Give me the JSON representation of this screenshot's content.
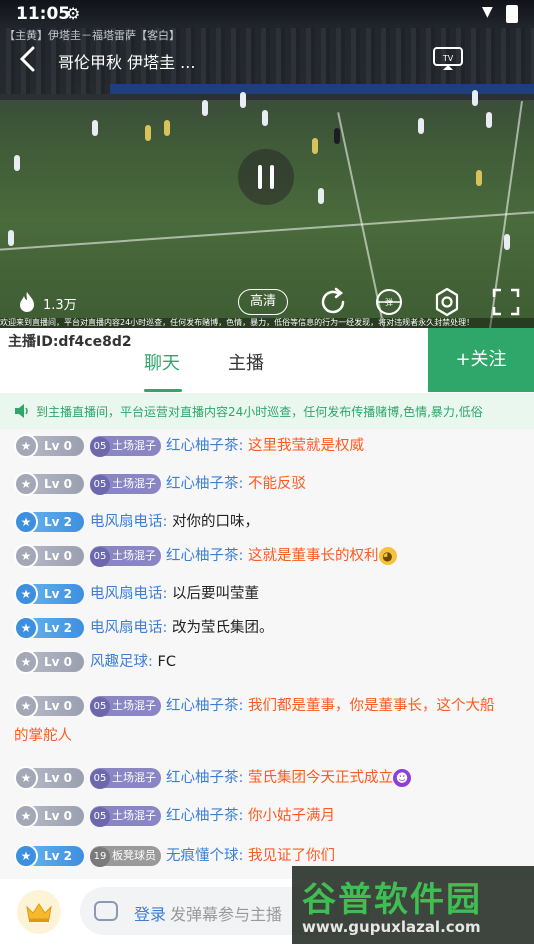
{
  "status_bar": {
    "time": "11:05"
  },
  "video": {
    "source_overlay": "【主黄】伊塔圭－福塔雷萨【客白】",
    "title": "哥伦甲秋 伊塔圭 ...",
    "viewer_count": "1.3万",
    "quality_label": "高清",
    "ticker": "欢迎来到直播间，平台对直播内容24小时巡查，任何发布赌博，色情，暴力，低俗等信息的行为一经发现，将对违规者永久封禁处理！"
  },
  "room": {
    "anchor_id": "主播ID:df4ce8d2",
    "tabs": [
      "聊天",
      "主播"
    ],
    "follow_label": "+关注"
  },
  "notice": {
    "text": "到主播直播间，平台运营对直播内容24小时巡查，任何发布传播赌博,色情,暴力,低俗"
  },
  "messages": [
    {
      "level": "Lv 0",
      "badge_num": "05",
      "badge": "土场混子",
      "user": "红心柚子茶:",
      "text": "这里我莹就是权威",
      "text_color": "orange"
    },
    {
      "level": "Lv 0",
      "badge_num": "05",
      "badge": "土场混子",
      "user": "红心柚子茶:",
      "text": "不能反驳",
      "text_color": "orange"
    },
    {
      "level": "Lv 2",
      "user": "电风扇电话:",
      "text": "对你的口味，",
      "text_color": "dark"
    },
    {
      "level": "Lv 0",
      "badge_num": "05",
      "badge": "土场混子",
      "user": "红心柚子茶:",
      "text": "这就是董事长的权利",
      "text_color": "orange"
    },
    {
      "level": "Lv 2",
      "user": "电风扇电话:",
      "text": "以后要叫莹董",
      "text_color": "dark"
    },
    {
      "level": "Lv 2",
      "user": "电风扇电话:",
      "text": "改为莹氏集团。",
      "text_color": "dark"
    },
    {
      "level": "Lv 0",
      "user": "风趣足球:",
      "text": "FC",
      "text_color": "dark"
    },
    {
      "level": "Lv 0",
      "badge_num": "05",
      "badge": "土场混子",
      "user": "红心柚子茶:",
      "text": "我们都是董事，你是董事长，这个大船",
      "text2": "的掌舵人",
      "text_color": "orange"
    },
    {
      "level": "Lv 0",
      "badge_num": "05",
      "badge": "土场混子",
      "user": "红心柚子茶:",
      "text": "莹氏集团今天正式成立",
      "text_color": "orange"
    },
    {
      "level": "Lv 0",
      "badge_num": "05",
      "badge": "土场混子",
      "user": "红心柚子茶:",
      "text": "你小姑子满月",
      "text_color": "orange"
    },
    {
      "level": "Lv 2",
      "badge_num": "19",
      "badge": "板凳球员",
      "user": "无痕懂个球:",
      "text": "我见证了你们",
      "text_color": "orange"
    }
  ],
  "input": {
    "login_label": "登录",
    "placeholder": "发弹幕参与主播"
  },
  "watermark": {
    "title": "谷普软件园",
    "url": "www.gupuxlazal.com"
  },
  "colors": {
    "accent": "#2fa66a",
    "username": "#3d7fd6",
    "highlight": "#ff5a1f"
  }
}
